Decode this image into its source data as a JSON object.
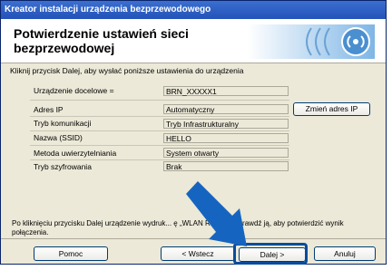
{
  "window": {
    "title": "Kreator instalacji urządzenia bezprzewodowego"
  },
  "header": {
    "title": "Potwierdzenie ustawień sieci bezprzewodowej"
  },
  "instructions": "Kliknij przycisk Dalej, aby wysłać poniższe ustawienia do urządzenia",
  "fields": {
    "target_device": {
      "label": "Urządzenie docelowe =",
      "value": "BRN_XXXXX1"
    },
    "ip_address": {
      "label": "Adres IP",
      "value": "Automatyczny"
    },
    "comm_mode": {
      "label": "Tryb komunikacji",
      "value": "Tryb Infrastrukturalny"
    },
    "ssid": {
      "label": "Nazwa (SSID)",
      "value": "HELLO"
    },
    "auth_method": {
      "label": "Metoda uwierzytelniania",
      "value": "System otwarty"
    },
    "encryption_mode": {
      "label": "Tryb szyfrowania",
      "value": "Brak"
    }
  },
  "buttons": {
    "change_ip": "Zmień adres IP",
    "help": "Pomoc",
    "back": "< Wstecz",
    "next": "Dalej >",
    "cancel": "Anuluj"
  },
  "footer_text": "Po kliknięciu przycisku Dalej urządzenie wydruk... ę „WLAN Report\". Sprawdź ją, aby potwierdzić wynik połączenia.",
  "colors": {
    "titlebar": "#2352b8",
    "window_bg": "#ece9d8",
    "arrow": "#1565c0"
  }
}
